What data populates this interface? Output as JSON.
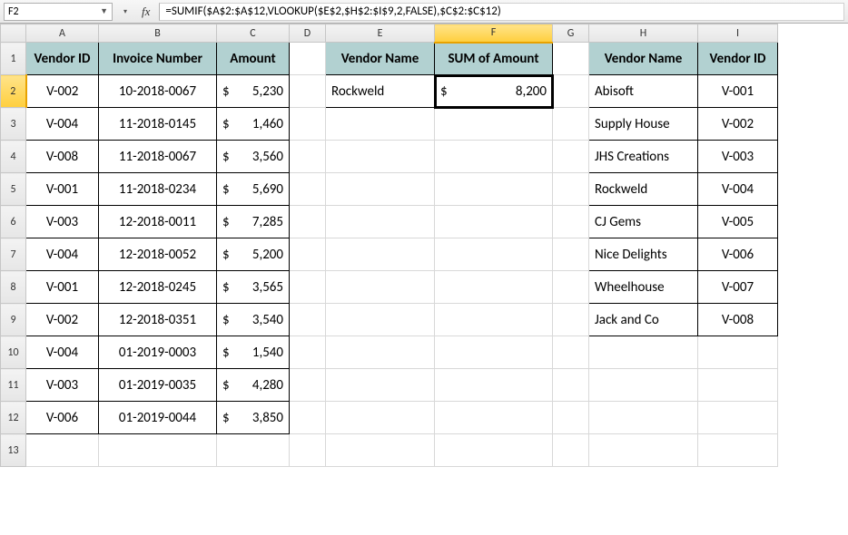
{
  "namebox": "F2",
  "fx_label": "fx",
  "formula": "=SUMIF($A$2:$A$12,VLOOKUP($E$2,$H$2:$I$9,2,FALSE),$C$2:$C$12)",
  "columns": [
    "A",
    "B",
    "C",
    "D",
    "E",
    "F",
    "G",
    "H",
    "I"
  ],
  "row_count": 13,
  "active": {
    "col": "F",
    "row": 2
  },
  "headers_main": {
    "A": "Vendor ID",
    "B": "Invoice Number",
    "C": "Amount"
  },
  "headers_mid": {
    "E": "Vendor Name",
    "F": "SUM of Amount"
  },
  "headers_right": {
    "H": "Vendor Name",
    "I": "Vendor ID"
  },
  "main_rows": [
    {
      "vid": "V-002",
      "inv": "10-2018-0067",
      "amt": "5,230"
    },
    {
      "vid": "V-004",
      "inv": "11-2018-0145",
      "amt": "1,460"
    },
    {
      "vid": "V-008",
      "inv": "11-2018-0067",
      "amt": "3,560"
    },
    {
      "vid": "V-001",
      "inv": "11-2018-0234",
      "amt": "5,690"
    },
    {
      "vid": "V-003",
      "inv": "12-2018-0011",
      "amt": "7,285"
    },
    {
      "vid": "V-004",
      "inv": "12-2018-0052",
      "amt": "5,200"
    },
    {
      "vid": "V-001",
      "inv": "12-2018-0245",
      "amt": "3,565"
    },
    {
      "vid": "V-002",
      "inv": "12-2018-0351",
      "amt": "3,540"
    },
    {
      "vid": "V-004",
      "inv": "01-2019-0003",
      "amt": "1,540"
    },
    {
      "vid": "V-003",
      "inv": "01-2019-0035",
      "amt": "4,280"
    },
    {
      "vid": "V-006",
      "inv": "01-2019-0044",
      "amt": "3,850"
    }
  ],
  "mid_row": {
    "vendor": "Rockweld",
    "sum": "8,200"
  },
  "right_rows": [
    {
      "name": "Abisoft",
      "vid": "V-001"
    },
    {
      "name": "Supply House",
      "vid": "V-002"
    },
    {
      "name": "JHS Creations",
      "vid": "V-003"
    },
    {
      "name": "Rockweld",
      "vid": "V-004"
    },
    {
      "name": "CJ Gems",
      "vid": "V-005"
    },
    {
      "name": "Nice Delights",
      "vid": "V-006"
    },
    {
      "name": "Wheelhouse",
      "vid": "V-007"
    },
    {
      "name": "Jack and Co",
      "vid": "V-008"
    }
  ]
}
